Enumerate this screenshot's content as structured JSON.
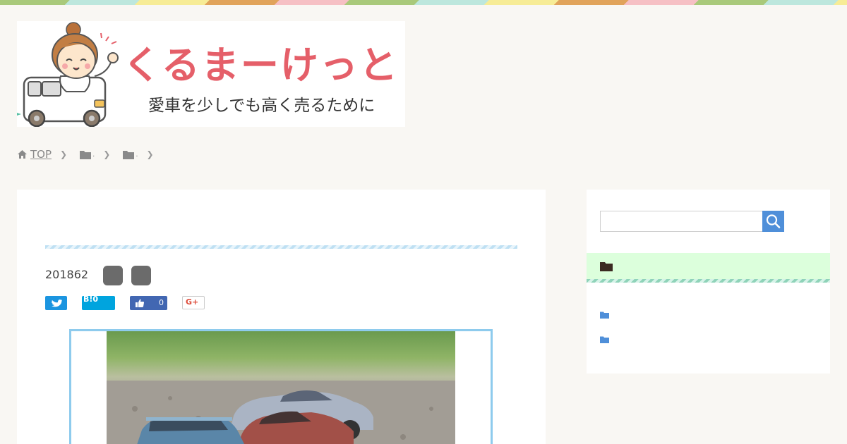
{
  "site": {
    "title": "くるまーけっと",
    "tagline": "愛車を少しでも高く売るために"
  },
  "breadcrumb": {
    "home_label": "TOP",
    "items": [
      ".",
      "."
    ]
  },
  "article": {
    "date": "201862",
    "share": {
      "hatena_label": "B!0",
      "facebook_count": "0",
      "google_label": "G+"
    }
  },
  "sidebar": {
    "search": {
      "placeholder": ""
    }
  },
  "colors": {
    "background": "#f9f7f3",
    "title_red": "#e55f69",
    "link_blue": "#4f8fd9",
    "category_head_bg": "#dcffdc",
    "eyecatch_border": "#8ecbed"
  },
  "icons": [
    "home-icon",
    "folder-icon",
    "chevron-right-icon",
    "twitter-icon",
    "hatena-bookmark-icon",
    "facebook-like-icon",
    "google-plus-icon",
    "search-icon"
  ]
}
